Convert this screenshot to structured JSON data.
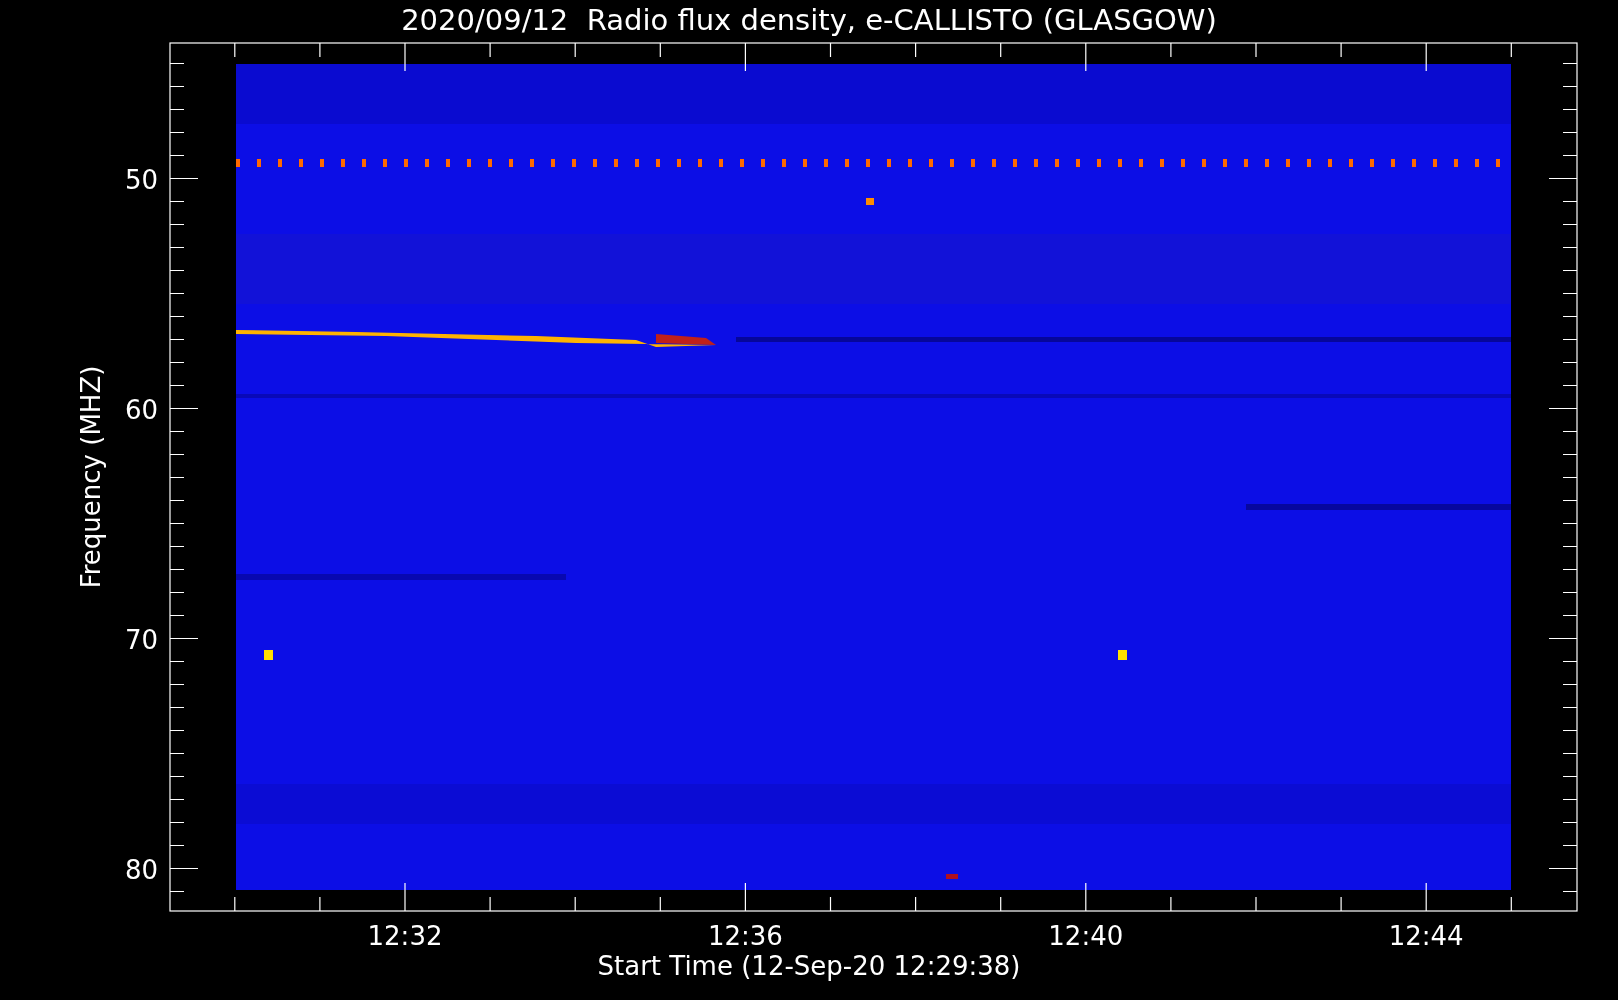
{
  "title": "2020/09/12  Radio flux density, e-CALLISTO (GLASGOW)",
  "y_axis": {
    "label": "Frequency (MHZ)",
    "ticks": [
      "50",
      "60",
      "70",
      "80"
    ]
  },
  "x_axis": {
    "label": "Start Time (12-Sep-20 12:29:38)",
    "ticks": [
      "12:32",
      "12:36",
      "12:40",
      "12:44"
    ]
  }
}
